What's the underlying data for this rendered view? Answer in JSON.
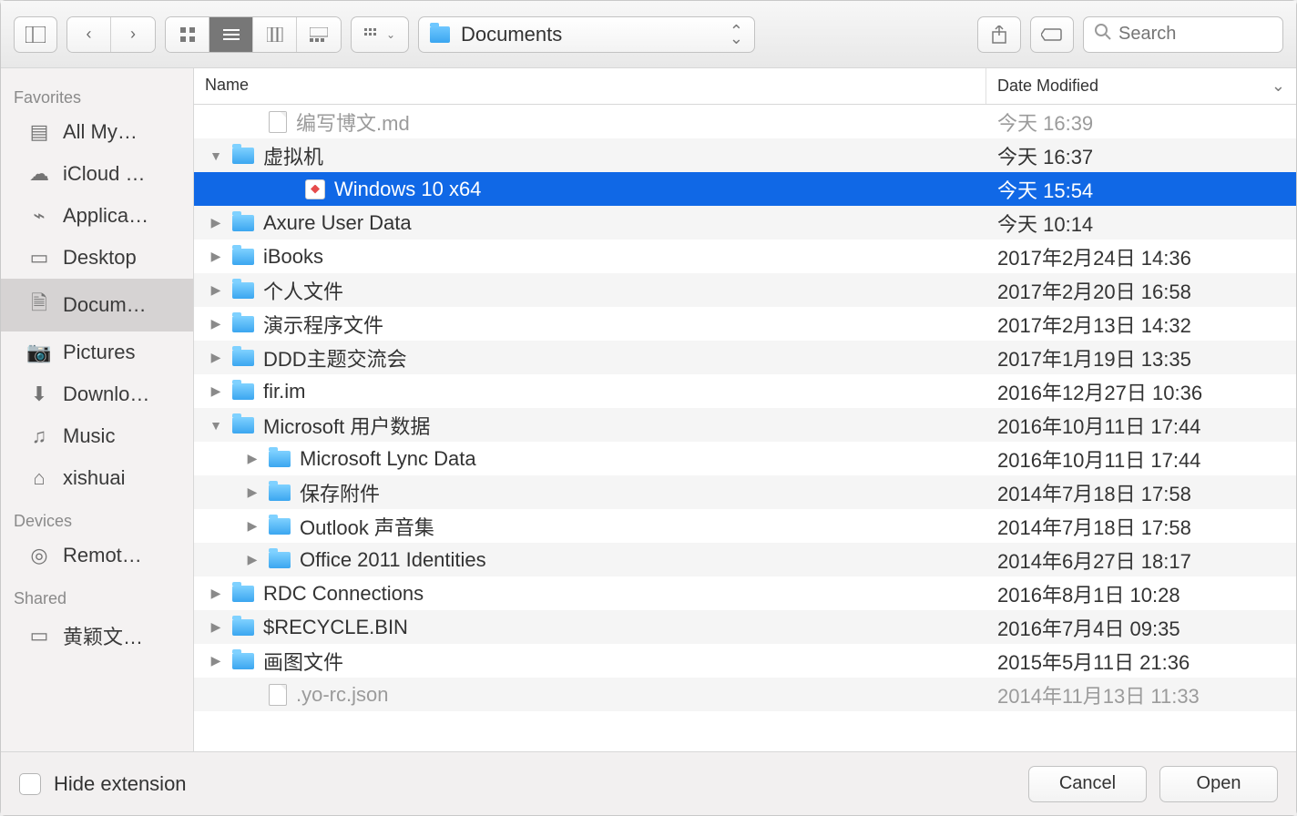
{
  "toolbar": {
    "path_label": "Documents",
    "search_placeholder": "Search"
  },
  "sidebar": {
    "sections": [
      {
        "header": "Favorites",
        "items": [
          {
            "icon": "all-files-icon",
            "glyph": "▤",
            "label": "All My…"
          },
          {
            "icon": "cloud-icon",
            "glyph": "☁",
            "label": "iCloud …"
          },
          {
            "icon": "apps-icon",
            "glyph": "⌁",
            "label": "Applica…"
          },
          {
            "icon": "desktop-icon",
            "glyph": "▭",
            "label": "Desktop"
          },
          {
            "icon": "documents-icon",
            "glyph": "🗎",
            "label": "Docum…",
            "active": true
          },
          {
            "icon": "pictures-icon",
            "glyph": "📷",
            "label": "Pictures"
          },
          {
            "icon": "downloads-icon",
            "glyph": "⬇",
            "label": "Downlo…"
          },
          {
            "icon": "music-icon",
            "glyph": "♫",
            "label": "Music"
          },
          {
            "icon": "home-icon",
            "glyph": "⌂",
            "label": "xishuai"
          }
        ]
      },
      {
        "header": "Devices",
        "items": [
          {
            "icon": "disc-icon",
            "glyph": "◎",
            "label": "Remot…"
          }
        ]
      },
      {
        "header": "Shared",
        "items": [
          {
            "icon": "computer-icon",
            "glyph": "▭",
            "label": "黄颖文…"
          }
        ]
      }
    ]
  },
  "columns": {
    "name": "Name",
    "date": "Date Modified"
  },
  "rows": [
    {
      "indent": 1,
      "disclosure": "",
      "icon": "doc",
      "name": "编写博文.md",
      "date": "今天 16:39",
      "dim": true
    },
    {
      "indent": 0,
      "disclosure": "▼",
      "icon": "folder",
      "name": "虚拟机",
      "date": "今天 16:37"
    },
    {
      "indent": 2,
      "disclosure": "",
      "icon": "vm",
      "name": "Windows 10 x64",
      "date": "今天 15:54",
      "selected": true
    },
    {
      "indent": 0,
      "disclosure": "▶",
      "icon": "folder",
      "name": "Axure User Data",
      "date": "今天 10:14"
    },
    {
      "indent": 0,
      "disclosure": "▶",
      "icon": "folder",
      "name": "iBooks",
      "date": "2017年2月24日 14:36"
    },
    {
      "indent": 0,
      "disclosure": "▶",
      "icon": "folder",
      "name": "个人文件",
      "date": "2017年2月20日 16:58"
    },
    {
      "indent": 0,
      "disclosure": "▶",
      "icon": "folder",
      "name": "演示程序文件",
      "date": "2017年2月13日 14:32"
    },
    {
      "indent": 0,
      "disclosure": "▶",
      "icon": "folder",
      "name": "DDD主题交流会",
      "date": "2017年1月19日 13:35"
    },
    {
      "indent": 0,
      "disclosure": "▶",
      "icon": "folder",
      "name": "fir.im",
      "date": "2016年12月27日 10:36"
    },
    {
      "indent": 0,
      "disclosure": "▼",
      "icon": "folder",
      "name": "Microsoft 用户数据",
      "date": "2016年10月11日 17:44"
    },
    {
      "indent": 1,
      "disclosure": "▶",
      "icon": "folder",
      "name": "Microsoft Lync Data",
      "date": "2016年10月11日 17:44"
    },
    {
      "indent": 1,
      "disclosure": "▶",
      "icon": "folder",
      "name": "保存附件",
      "date": "2014年7月18日 17:58"
    },
    {
      "indent": 1,
      "disclosure": "▶",
      "icon": "folder",
      "name": "Outlook 声音集",
      "date": "2014年7月18日 17:58"
    },
    {
      "indent": 1,
      "disclosure": "▶",
      "icon": "folder",
      "name": "Office 2011 Identities",
      "date": "2014年6月27日 18:17"
    },
    {
      "indent": 0,
      "disclosure": "▶",
      "icon": "folder",
      "name": "RDC Connections",
      "date": "2016年8月1日 10:28"
    },
    {
      "indent": 0,
      "disclosure": "▶",
      "icon": "folder",
      "name": "$RECYCLE.BIN",
      "date": "2016年7月4日 09:35"
    },
    {
      "indent": 0,
      "disclosure": "▶",
      "icon": "folder",
      "name": "画图文件",
      "date": "2015年5月11日 21:36"
    },
    {
      "indent": 1,
      "disclosure": "",
      "icon": "doc",
      "name": ".yo-rc.json",
      "date": "2014年11月13日 11:33",
      "dim": true
    }
  ],
  "footer": {
    "hide_ext": "Hide extension",
    "cancel": "Cancel",
    "open": "Open"
  }
}
